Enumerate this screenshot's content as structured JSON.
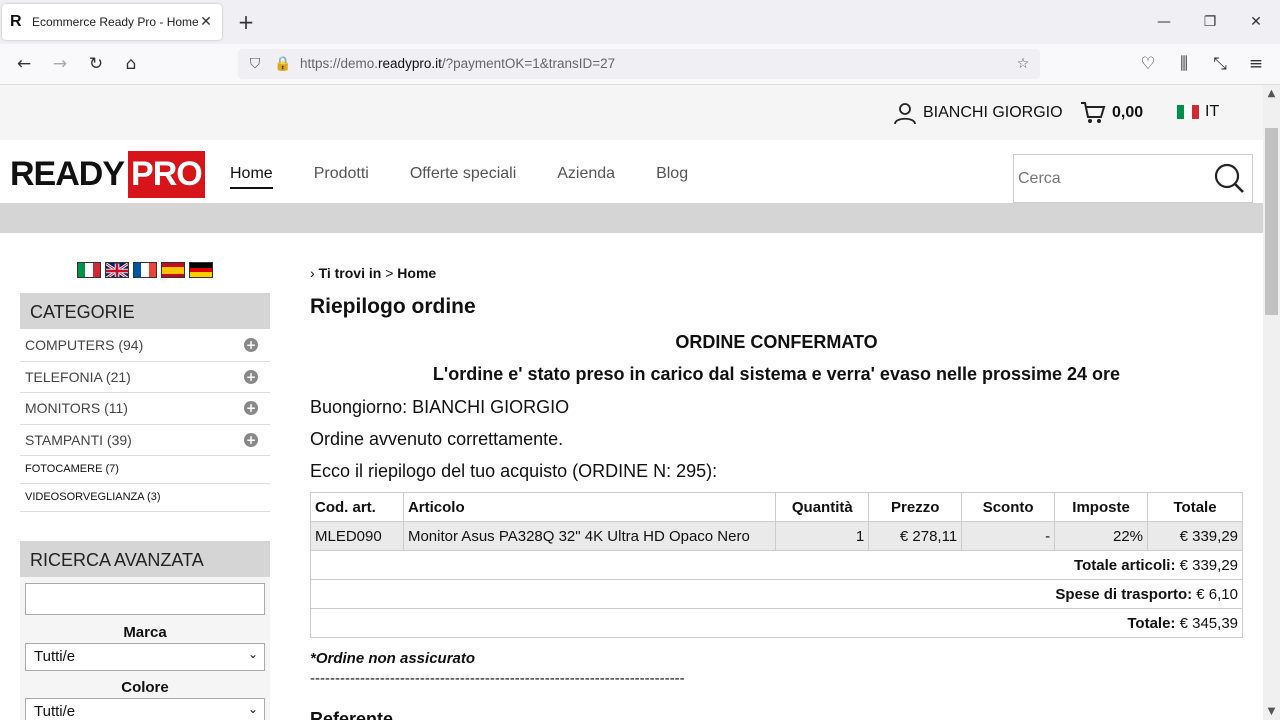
{
  "browser": {
    "tab_title": "Ecommerce Ready Pro - Home",
    "favicon_letter": "R",
    "url_prefix": "https://demo.",
    "url_domain": "readypro.it",
    "url_path": "/?paymentOK=1&transID=27",
    "icons": [
      "back-arrow-icon",
      "forward-arrow-icon",
      "reload-icon",
      "home-icon",
      "shield-icon",
      "lock-icon",
      "star-icon",
      "pocket-icon",
      "library-icon",
      "extensions-icon",
      "menu-icon"
    ]
  },
  "topbar": {
    "user_name": "BIANCHI GIORGIO",
    "cart_total": "0,00",
    "language": "IT"
  },
  "header": {
    "logo_ready": "READY",
    "logo_pro": "PRO",
    "nav": [
      "Home",
      "Prodotti",
      "Offerte speciali",
      "Azienda",
      "Blog"
    ],
    "search_placeholder": "Cerca"
  },
  "sidebar": {
    "categories_title": "CATEGORIE",
    "categories": [
      "COMPUTERS (94)",
      "TELEFONIA (21)",
      "MONITORS (11)",
      "STAMPANTI (39)",
      "FOTOCAMERE (7)",
      "VIDEOSORVEGLIANZA (3)"
    ],
    "advanced_title": "RICERCA AVANZATA",
    "brand_label": "Marca",
    "brand_value": "Tutti/e",
    "color_label": "Colore",
    "color_value": "Tutti/e"
  },
  "main": {
    "breadcrumb_label": "Ti trovi in",
    "breadcrumb_sep": ">",
    "breadcrumb_current": "Home",
    "title": "Riepilogo ordine",
    "confirmed": "ORDINE CONFERMATO",
    "confirmed_sub": "L'ordine e' stato preso in carico dal sistema e verra' evaso nelle prossime 24 ore",
    "greeting": "Buongiorno: BIANCHI GIORGIO",
    "success": "Ordine avvenuto correttamente.",
    "summary": "Ecco il riepilogo del tuo acquisto (ORDINE N: 295):",
    "table": {
      "headers": [
        "Cod. art.",
        "Articolo",
        "Quantità",
        "Prezzo",
        "Sconto",
        "Imposte",
        "Totale"
      ],
      "row": [
        "MLED090",
        "Monitor Asus PA328Q 32\" 4K Ultra HD Opaco Nero",
        "1",
        "€ 278,11",
        "-",
        "22%",
        "€ 339,29"
      ],
      "items_total_label": "Totale articoli:",
      "items_total_value": "€ 339,29",
      "shipping_label": "Spese di trasporto:",
      "shipping_value": "€ 6,10",
      "grand_total_label": "Totale:",
      "grand_total_value": "€ 345,39"
    },
    "note": "*Ordine non assicurato",
    "dashes": "---------------------------------------------------------------------------",
    "next_heading": "Referente"
  }
}
